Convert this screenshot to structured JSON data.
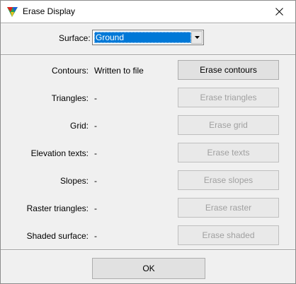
{
  "window": {
    "title": "Erase Display",
    "close_glyph": "✕"
  },
  "surface": {
    "label": "Surface:",
    "value": "Ground"
  },
  "rows": [
    {
      "label": "Contours:",
      "value": "Written to file",
      "button": "Erase contours",
      "enabled": true
    },
    {
      "label": "Triangles:",
      "value": "-",
      "button": "Erase triangles",
      "enabled": false
    },
    {
      "label": "Grid:",
      "value": "-",
      "button": "Erase grid",
      "enabled": false
    },
    {
      "label": "Elevation texts:",
      "value": "-",
      "button": "Erase texts",
      "enabled": false
    },
    {
      "label": "Slopes:",
      "value": "-",
      "button": "Erase slopes",
      "enabled": false
    },
    {
      "label": "Raster triangles:",
      "value": "-",
      "button": "Erase raster",
      "enabled": false
    },
    {
      "label": "Shaded surface:",
      "value": "-",
      "button": "Erase shaded",
      "enabled": false
    }
  ],
  "ok_label": "OK",
  "colors": {
    "selection": "#0078d7",
    "disabled_text": "#a0a0a0"
  }
}
